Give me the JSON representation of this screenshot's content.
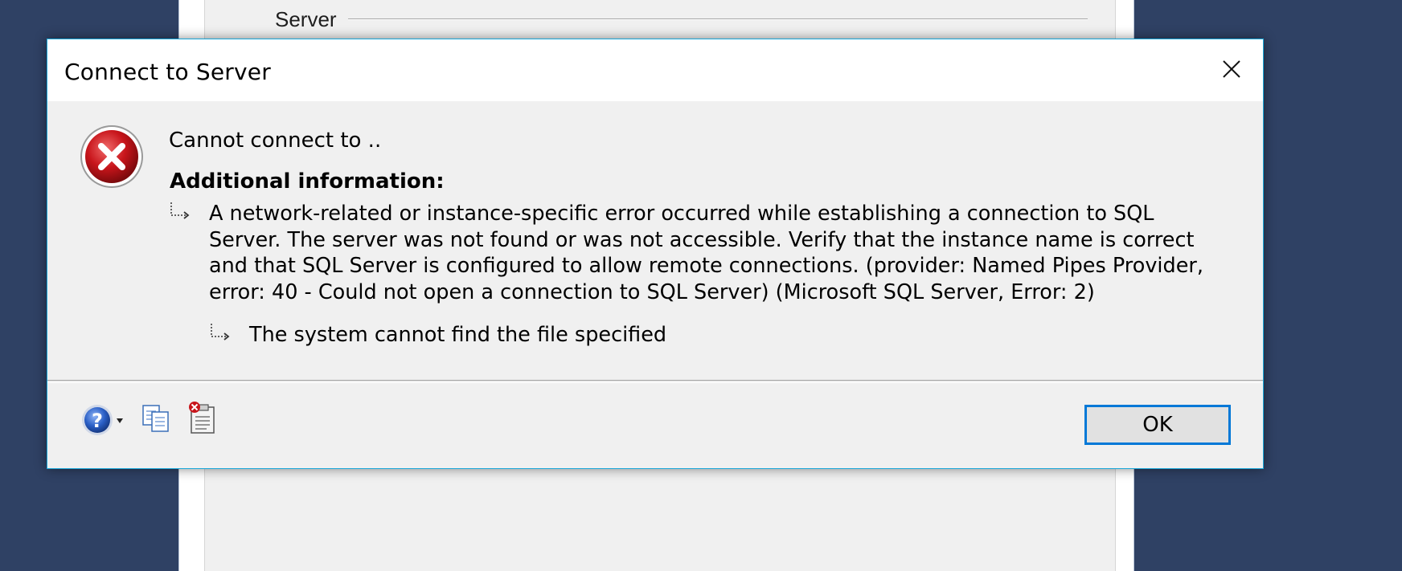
{
  "background_window": {
    "group_label": "Server"
  },
  "dialog": {
    "title": "Connect to Server",
    "main_message": "Cannot connect to ..",
    "additional_info_label": "Additional information:",
    "detail_message": "A network-related or instance-specific error occurred while establishing a connection to SQL Server. The server was not found or was not accessible. Verify that the instance name is correct and that SQL Server is configured to allow remote connections. (provider: Named Pipes Provider, error: 40 - Could not open a connection to SQL Server) (Microsoft SQL Server, Error: 2)",
    "inner_message": "The system cannot find the file specified",
    "ok_label": "OK",
    "icons": {
      "error": "error-icon",
      "close": "close-icon",
      "help": "help-icon",
      "copy": "copy-icon",
      "details": "show-technical-details-icon"
    },
    "colors": {
      "accent_border": "#18a6d8",
      "button_focus": "#0078d7",
      "error_red": "#c8151b",
      "help_blue": "#2a5fc6"
    }
  }
}
